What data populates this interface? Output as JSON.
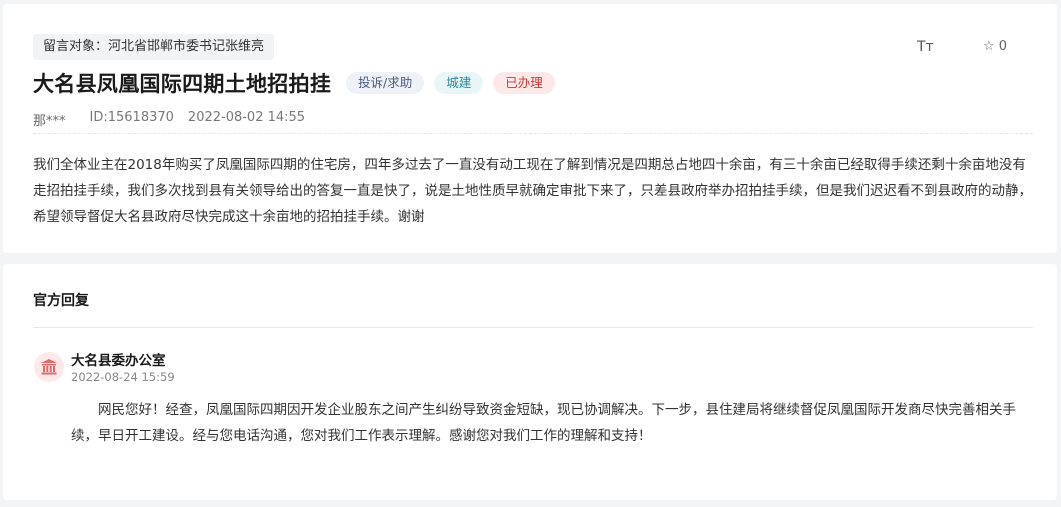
{
  "message": {
    "target_label": "留言对象：河北省邯郸市委书记张维亮",
    "title": "大名县凤凰国际四期土地招拍挂",
    "tags": [
      {
        "label": "投诉/求助"
      },
      {
        "label": "城建"
      },
      {
        "label": "已办理"
      }
    ],
    "font_tool_icon": "text-size-icon",
    "font_tool_label": "Tт",
    "star_icon": "star-outline-icon",
    "star_count": "0",
    "author": "那***",
    "id_label": "ID:15618370",
    "datetime": "2022-08-02 14:55",
    "content": "我们全体业主在2018年购买了凤凰国际四期的住宅房，四年多过去了一直没有动工现在了解到情况是四期总占地四十余亩，有三十余亩已经取得手续还剩十余亩地没有走招拍挂手续，我们多次找到县有关领导给出的答复一直是快了，说是土地性质早就确定审批下来了，只差县政府举办招拍挂手续，但是我们迟迟看不到县政府的动静，希望领导督促大名县政府尽快完成这十余亩地的招拍挂手续。谢谢"
  },
  "reply": {
    "section_title": "官方回复",
    "org_icon": "government-building-icon",
    "org_name": "大名县委办公室",
    "datetime": "2022-08-24 15:59",
    "content": "网民您好！经查，凤凰国际四期因开发企业股东之间产生纠纷导致资金短缺，现已协调解决。下一步，县住建局将继续督促凤凰国际开发商尽快完善相关手续，早日开工建设。经与您电话沟通，您对我们工作表示理解。感谢您对我们工作的理解和支持！"
  },
  "colors": {
    "tag_type": "#4a5d7e",
    "tag_category": "#2b8a9b",
    "tag_status": "#d0373a",
    "avatar_bg": "#fde9e9",
    "avatar_icon": "#e06a6a"
  }
}
